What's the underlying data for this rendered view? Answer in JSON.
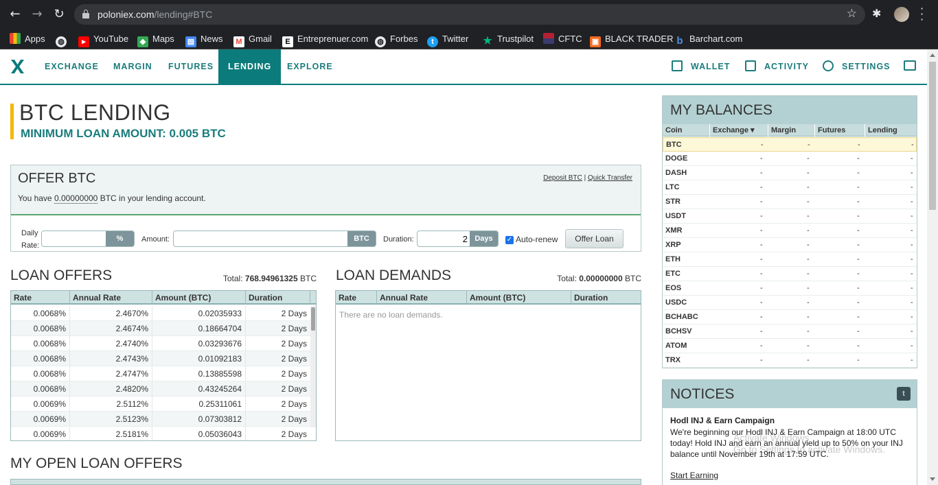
{
  "browser": {
    "url_host": "poloniex.com",
    "url_path": "/lending#BTC",
    "bookmarks": [
      "Apps",
      "YouTube",
      "Maps",
      "News",
      "Gmail",
      "Entreprenuer.com",
      "Forbes",
      "Twitter",
      "Trustpilot",
      "CFTC",
      "BLACK TRADER",
      "Barchart.com"
    ]
  },
  "nav": {
    "items": [
      "EXCHANGE",
      "MARGIN",
      "FUTURES",
      "LENDING",
      "EXPLORE"
    ],
    "active": "LENDING",
    "right": [
      "WALLET",
      "ACTIVITY",
      "SETTINGS"
    ]
  },
  "page": {
    "title": "BTC LENDING",
    "min_loan": "MINIMUM LOAN AMOUNT: 0.005 BTC"
  },
  "offer": {
    "title": "OFFER BTC",
    "text_prefix": "You have ",
    "balance": "0.00000000",
    "text_suffix": " BTC in your lending account.",
    "link_deposit": "Deposit BTC",
    "link_sep": "|",
    "link_transfer": "Quick Transfer",
    "daily_rate_label_1": "Daily",
    "daily_rate_label_2": "Rate:",
    "rate_suffix": "%",
    "amount_label": "Amount:",
    "amount_suffix": "BTC",
    "duration_label": "Duration:",
    "duration_value": "2",
    "duration_suffix": "Days",
    "autorenew_label": "Auto-renew",
    "submit": "Offer Loan"
  },
  "loan_offers": {
    "title": "LOAN OFFERS",
    "total_label": "Total:",
    "total_value": "768.94961325",
    "total_unit": "BTC",
    "headers": [
      "Rate",
      "Annual Rate",
      "Amount (BTC)",
      "Duration"
    ],
    "rows": [
      [
        "0.0068%",
        "2.4670%",
        "0.02035933",
        "2 Days"
      ],
      [
        "0.0068%",
        "2.4674%",
        "0.18664704",
        "2 Days"
      ],
      [
        "0.0068%",
        "2.4740%",
        "0.03293676",
        "2 Days"
      ],
      [
        "0.0068%",
        "2.4743%",
        "0.01092183",
        "2 Days"
      ],
      [
        "0.0068%",
        "2.4747%",
        "0.13885598",
        "2 Days"
      ],
      [
        "0.0068%",
        "2.4820%",
        "0.43245264",
        "2 Days"
      ],
      [
        "0.0069%",
        "2.5112%",
        "0.25311061",
        "2 Days"
      ],
      [
        "0.0069%",
        "2.5123%",
        "0.07303812",
        "2 Days"
      ],
      [
        "0.0069%",
        "2.5181%",
        "0.05036043",
        "2 Days"
      ]
    ]
  },
  "loan_demands": {
    "title": "LOAN DEMANDS",
    "total_label": "Total:",
    "total_value": "0.00000000",
    "total_unit": "BTC",
    "headers": [
      "Rate",
      "Annual Rate",
      "Amount (BTC)",
      "Duration"
    ],
    "empty": "There are no loan demands."
  },
  "open_offers": {
    "title": "MY OPEN LOAN OFFERS"
  },
  "balances": {
    "title": "MY BALANCES",
    "headers": [
      "Coin",
      "Exchange ▾",
      "Margin",
      "Futures",
      "Lending"
    ],
    "rows": [
      {
        "coin": "BTC",
        "v": [
          "-",
          "-",
          "-",
          "-"
        ]
      },
      {
        "coin": "DOGE",
        "v": [
          "-",
          "-",
          "-",
          "-"
        ]
      },
      {
        "coin": "DASH",
        "v": [
          "-",
          "-",
          "-",
          "-"
        ]
      },
      {
        "coin": "LTC",
        "v": [
          "-",
          "-",
          "-",
          "-"
        ]
      },
      {
        "coin": "STR",
        "v": [
          "-",
          "-",
          "-",
          "-"
        ]
      },
      {
        "coin": "USDT",
        "v": [
          "-",
          "-",
          "-",
          "-"
        ]
      },
      {
        "coin": "XMR",
        "v": [
          "-",
          "-",
          "-",
          "-"
        ]
      },
      {
        "coin": "XRP",
        "v": [
          "-",
          "-",
          "-",
          "-"
        ]
      },
      {
        "coin": "ETH",
        "v": [
          "-",
          "-",
          "-",
          "-"
        ]
      },
      {
        "coin": "ETC",
        "v": [
          "-",
          "-",
          "-",
          "-"
        ]
      },
      {
        "coin": "EOS",
        "v": [
          "-",
          "-",
          "-",
          "-"
        ]
      },
      {
        "coin": "USDC",
        "v": [
          "-",
          "-",
          "-",
          "-"
        ]
      },
      {
        "coin": "BCHABC",
        "v": [
          "-",
          "-",
          "-",
          "-"
        ]
      },
      {
        "coin": "BCHSV",
        "v": [
          "-",
          "-",
          "-",
          "-"
        ]
      },
      {
        "coin": "ATOM",
        "v": [
          "-",
          "-",
          "-",
          "-"
        ]
      },
      {
        "coin": "TRX",
        "v": [
          "-",
          "-",
          "-",
          "-"
        ]
      }
    ]
  },
  "notices": {
    "title": "NOTICES",
    "heading": "Hodl INJ & Earn Campaign",
    "body": "We're beginning our Hodl INJ & Earn Campaign at 18:00 UTC today! Hold INJ and earn an annual yield up to 50% on your INJ balance until November 19th at 17:59 UTC.",
    "link": "Start Earning"
  },
  "watermark": {
    "line1": "Activate Windows",
    "line2": "Go to Settings to activate Windows."
  },
  "colors": {
    "brand": "#0c7b7b",
    "accent": "#f5b700",
    "panel_header": "#b3d1d3"
  }
}
